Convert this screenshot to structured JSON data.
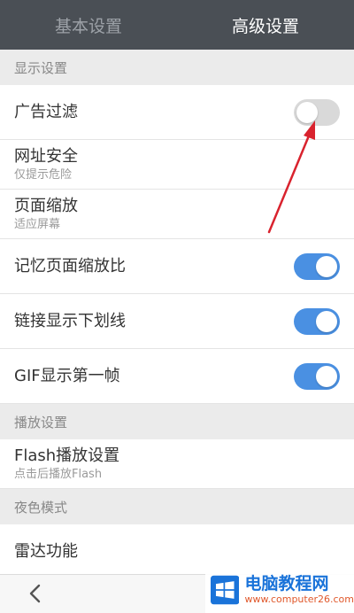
{
  "tabs": [
    {
      "label": "基本设置",
      "active": false
    },
    {
      "label": "高级设置",
      "active": true
    }
  ],
  "sections": {
    "display": {
      "header": "显示设置",
      "ad_filter": {
        "title": "广告过滤",
        "toggle": "off"
      },
      "url_security": {
        "title": "网址安全",
        "subtitle": "仅提示危险"
      },
      "page_zoom": {
        "title": "页面缩放",
        "subtitle": "适应屏幕"
      },
      "remember_zoom": {
        "title": "记忆页面缩放比",
        "toggle": "on"
      },
      "link_underline": {
        "title": "链接显示下划线",
        "toggle": "on"
      },
      "gif_first_frame": {
        "title": "GIF显示第一帧",
        "toggle": "on"
      }
    },
    "playback": {
      "header": "播放设置",
      "flash": {
        "title": "Flash播放设置",
        "subtitle": "点击后播放Flash"
      }
    },
    "night": {
      "header": "夜色模式",
      "radar": {
        "title": "雷达功能"
      }
    }
  },
  "watermark": {
    "name": "电脑教程网",
    "url": "www.computer26.com"
  },
  "colors": {
    "tabbar_bg": "#4a4f55",
    "toggle_on": "#4a90e2",
    "toggle_off": "#d9d9d9",
    "annotation_arrow": "#d9232e"
  },
  "icons": {
    "back": "chevron-left-icon",
    "annotation": "red-arrow",
    "logo": "windows-logo-icon"
  }
}
